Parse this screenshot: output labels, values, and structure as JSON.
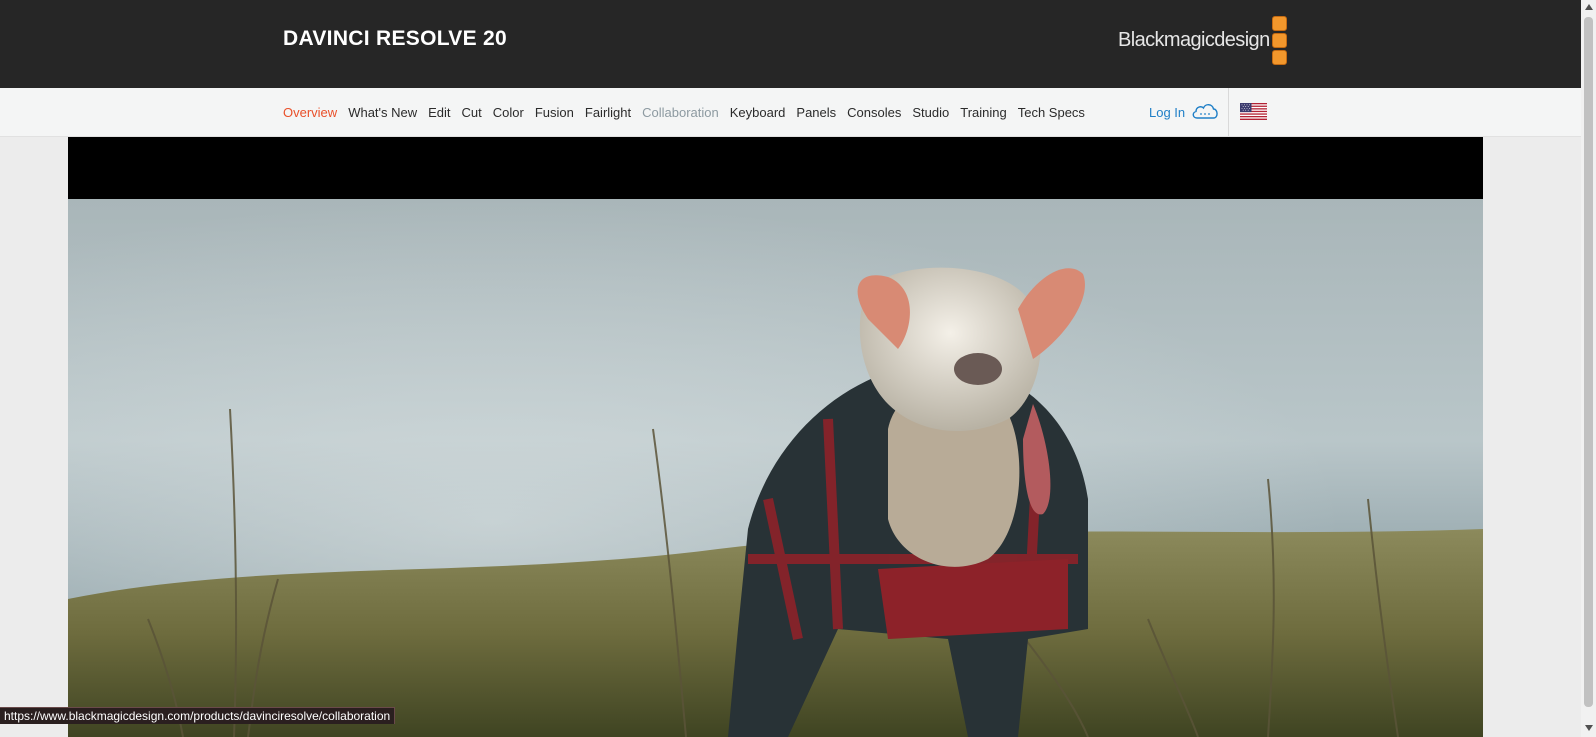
{
  "header": {
    "product_title": "DAVINCI RESOLVE 20",
    "logo_text": "Blackmagicdesign",
    "logo_icon": "three-orange-squares-logo"
  },
  "nav": {
    "items": [
      {
        "label": "Overview",
        "state": "active"
      },
      {
        "label": "What's New",
        "state": ""
      },
      {
        "label": "Edit",
        "state": ""
      },
      {
        "label": "Cut",
        "state": ""
      },
      {
        "label": "Color",
        "state": ""
      },
      {
        "label": "Fusion",
        "state": ""
      },
      {
        "label": "Fairlight",
        "state": ""
      },
      {
        "label": "Collaboration",
        "state": "hover"
      },
      {
        "label": "Keyboard",
        "state": ""
      },
      {
        "label": "Panels",
        "state": ""
      },
      {
        "label": "Consoles",
        "state": ""
      },
      {
        "label": "Studio",
        "state": ""
      },
      {
        "label": "Training",
        "state": ""
      },
      {
        "label": "Tech Specs",
        "state": ""
      }
    ],
    "login_label": "Log In",
    "login_icon": "cloud-icon",
    "region_icon": "us-flag-icon"
  },
  "video": {
    "content": "dog-in-plaid-coat-running-through-grass"
  },
  "status_bar": {
    "url": "https://www.blackmagicdesign.com/products/davinciresolve/collaboration"
  },
  "colors": {
    "topbar": "#262626",
    "navbar": "#f4f5f5",
    "active_link": "#e9502a",
    "hover_link": "#8d9aa1",
    "login_link": "#1f7fc7",
    "logo_orange": "#f2972c"
  }
}
